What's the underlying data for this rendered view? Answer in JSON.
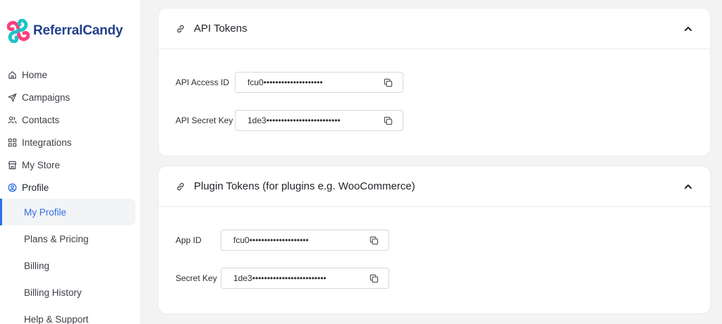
{
  "brand": {
    "name": "ReferralCandy"
  },
  "nav": {
    "items": [
      {
        "label": "Home",
        "icon": "home-icon"
      },
      {
        "label": "Campaigns",
        "icon": "send-icon"
      },
      {
        "label": "Contacts",
        "icon": "users-icon"
      },
      {
        "label": "Integrations",
        "icon": "grid-icon"
      },
      {
        "label": "My Store",
        "icon": "store-icon"
      },
      {
        "label": "Profile",
        "icon": "user-circle-icon",
        "active": true
      }
    ],
    "sub_items": [
      {
        "label": "My Profile",
        "selected": true
      },
      {
        "label": "Plans & Pricing"
      },
      {
        "label": "Billing"
      },
      {
        "label": "Billing History"
      },
      {
        "label": "Help & Support"
      }
    ]
  },
  "api_tokens": {
    "title": "API Tokens",
    "access_id_label": "API Access ID",
    "access_id_value": "fcu0••••••••••••••••••••",
    "secret_key_label": "API Secret Key",
    "secret_key_value": "1de3•••••••••••••••••••••••••"
  },
  "plugin_tokens": {
    "title": "Plugin Tokens (for plugins e.g. WooCommerce)",
    "app_id_label": "App ID",
    "app_id_value": "fcu0••••••••••••••••••••",
    "secret_key_label": "Secret Key",
    "secret_key_value": "1de3•••••••••••••••••••••••••"
  },
  "colors": {
    "accent": "#2e6fe3",
    "brand_text": "#22408c"
  }
}
